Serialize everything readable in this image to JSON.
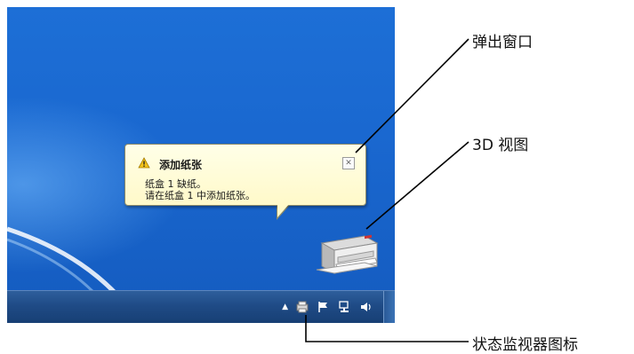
{
  "balloon": {
    "title": "添加纸张",
    "line1": "纸盒 1 缺纸。",
    "line2": "请在纸盒 1 中添加纸张。",
    "close_glyph": "✕"
  },
  "tray": {
    "overflow_glyph": "▲"
  },
  "annotations": {
    "popup": "弹出窗口",
    "view3d": "3D 视图",
    "status_icon": "状态监视器图标"
  },
  "colors": {
    "desktop": "#1a68d0",
    "balloon_bg": "#fff9c9",
    "taskbar": "#1f4b86"
  }
}
